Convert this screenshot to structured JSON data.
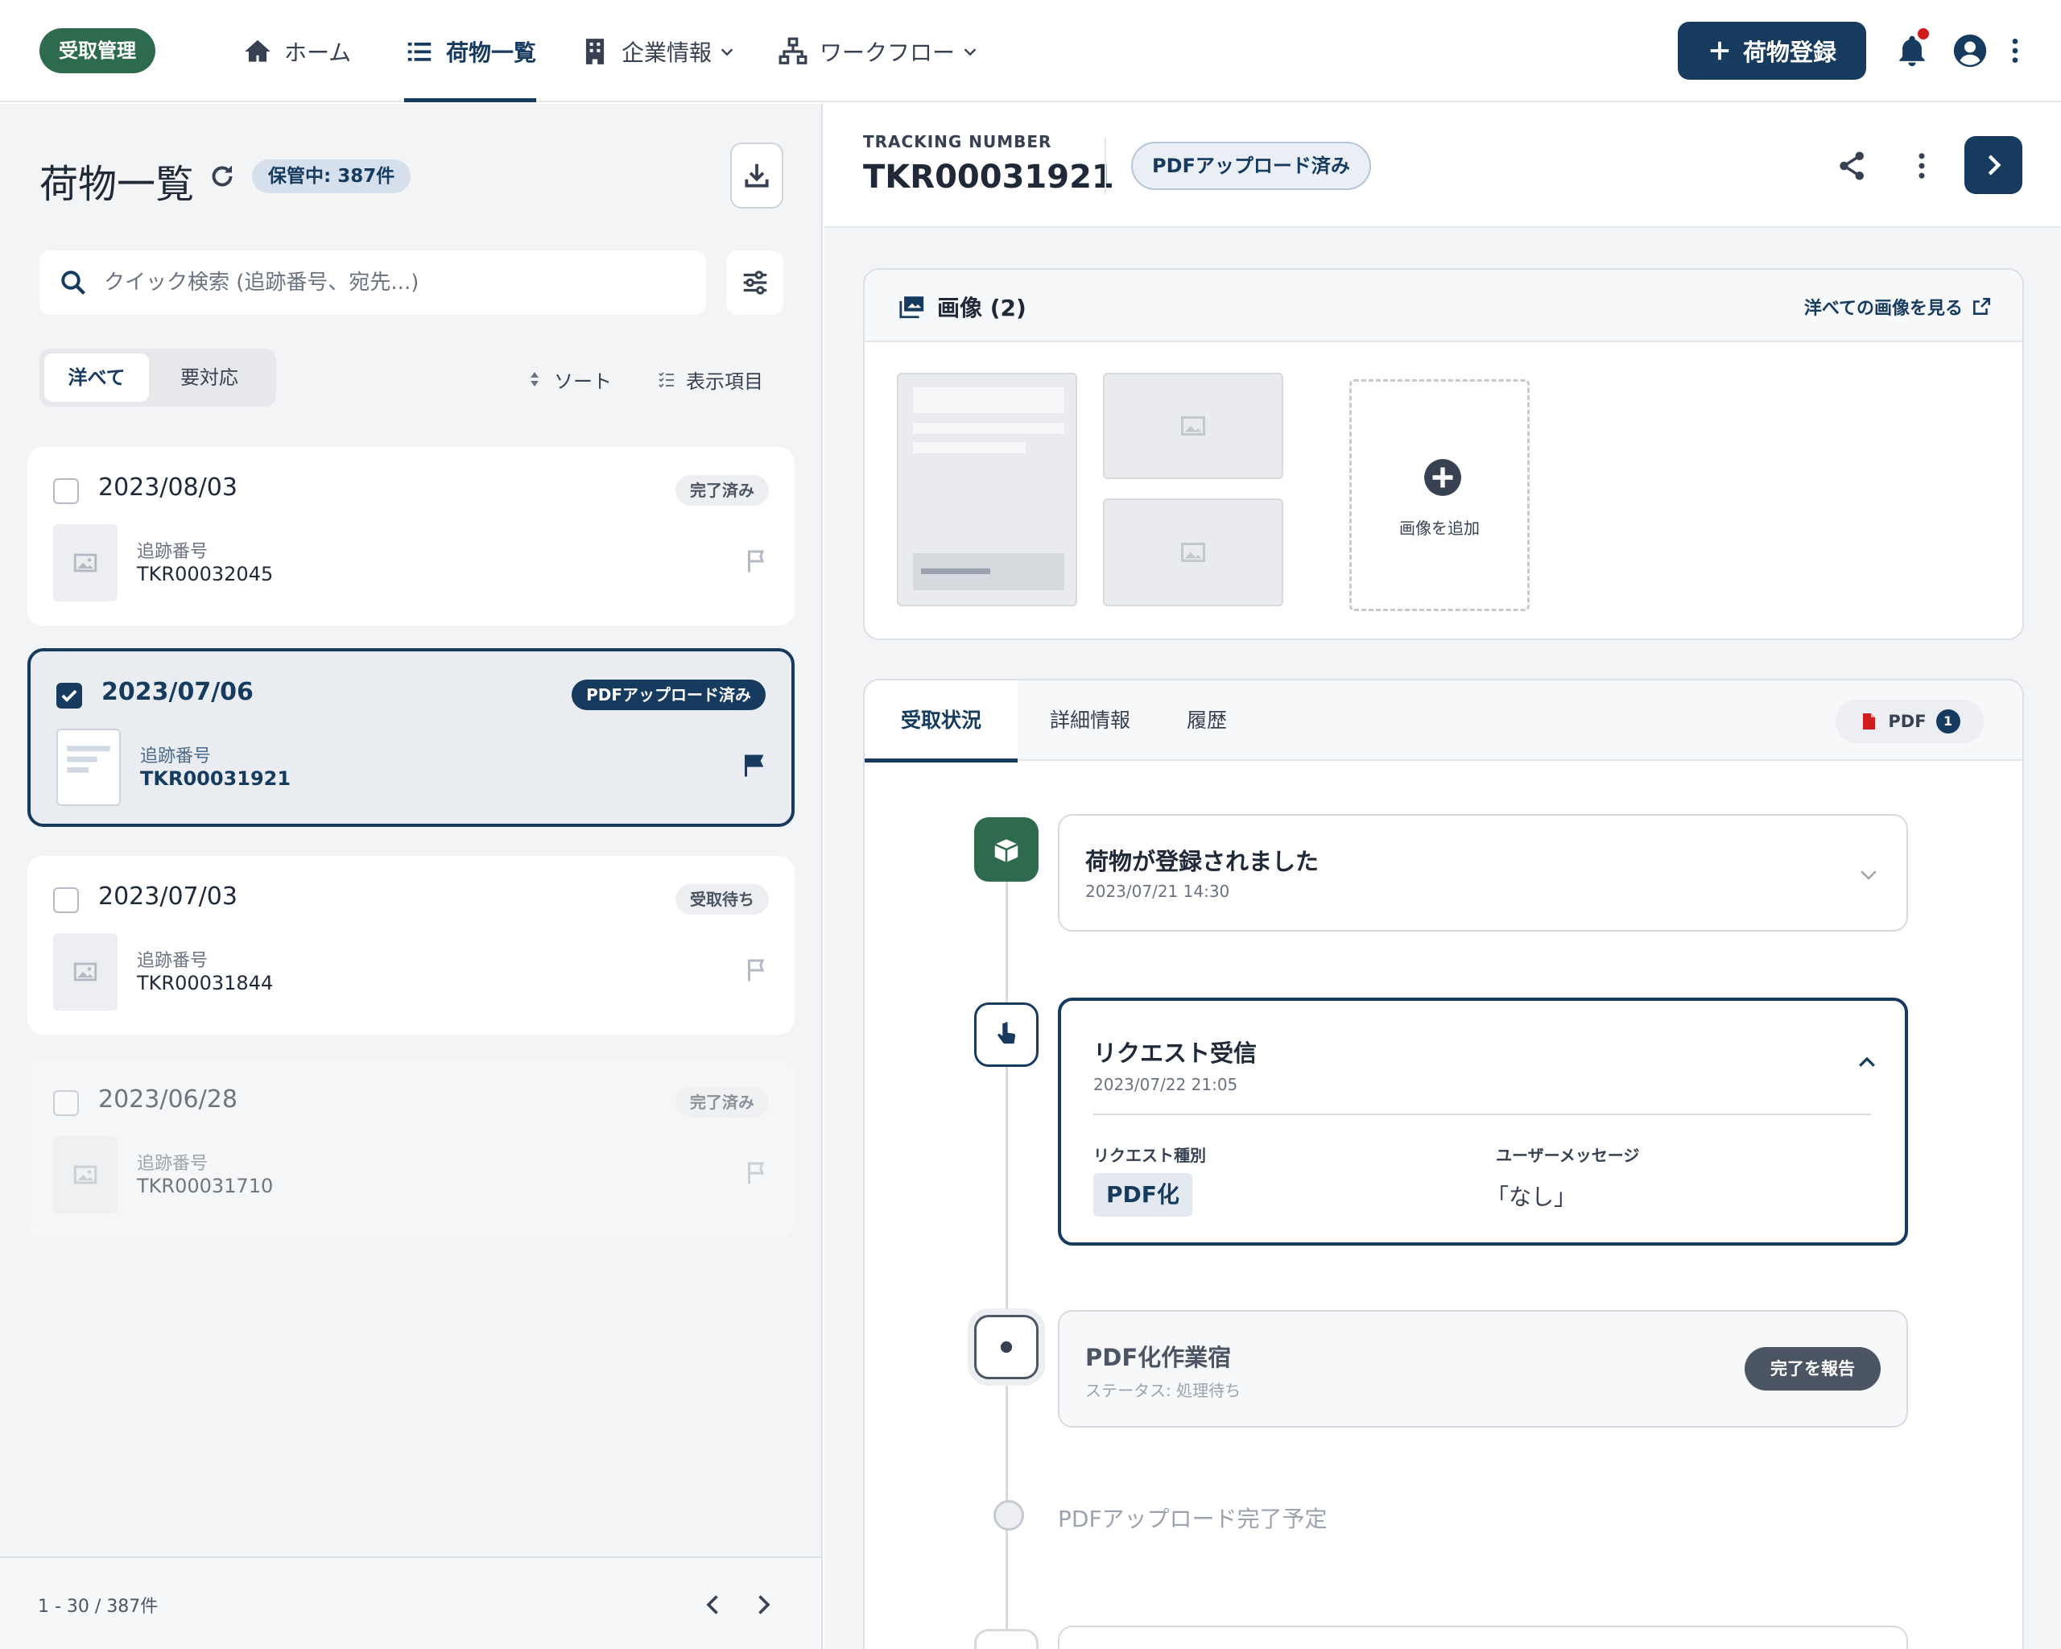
{
  "nav": {
    "brand": "受取管理",
    "items": [
      {
        "label": "ホーム"
      },
      {
        "label": "荷物一覧"
      },
      {
        "label": "企業情報"
      },
      {
        "label": "ワークフロー"
      }
    ],
    "register_label": "荷物登録"
  },
  "list": {
    "title": "荷物一覧",
    "stock_badge": "保管中: 387件",
    "search_placeholder": "クイック検索 (追跡番号、宛先...)",
    "seg_all": "洋べて",
    "seg_action": "要対応",
    "sort_label": "ソート",
    "columns_label": "表示項目",
    "tracking_label": "追跡番号",
    "items": [
      {
        "date": "2023/08/03",
        "status": "完了済み",
        "tracking": "TKR00032045",
        "checked": false
      },
      {
        "date": "2023/07/06",
        "status": "PDFアップロード済み",
        "tracking": "TKR00031921",
        "checked": true
      },
      {
        "date": "2023/07/03",
        "status": "受取待ち",
        "tracking": "TKR00031844",
        "checked": false
      },
      {
        "date": "2023/06/28",
        "status": "完了済み",
        "tracking": "TKR00031710",
        "checked": false
      }
    ],
    "pager": "1 - 30 / 387件"
  },
  "detail": {
    "tracking_label": "TRACKING NUMBER",
    "tracking_value": "TKR00031921",
    "status_badge": "PDFアップロード済み",
    "images": {
      "title": "画像 (2)",
      "view_all": "洋べての画像を見る",
      "add_label": "画像を追加"
    },
    "tabs": [
      {
        "label": "受取状況"
      },
      {
        "label": "詳細情報"
      },
      {
        "label": "履歴"
      }
    ],
    "pdf_chip": {
      "label": "PDF",
      "count": "1"
    },
    "timeline": {
      "registered": {
        "title": "荷物が登録されました",
        "time": "2023/07/21 14:30"
      },
      "request": {
        "title": "リクエスト受信",
        "time": "2023/07/22 21:05",
        "type_label": "リクエスト種別",
        "type_value": "PDF化",
        "message_label": "ユーザーメッセージ",
        "message_value": "「なし」"
      },
      "work": {
        "title": "PDF化作業宿",
        "status": "ステータス: 処理待ち",
        "button": "完了を報告"
      },
      "planned": {
        "title": "PDFアップロード完了予定"
      }
    }
  },
  "colors": {
    "primary": "#163b5f",
    "brand_green": "#2e6b4e",
    "notification_dot": "#d01c1c"
  }
}
